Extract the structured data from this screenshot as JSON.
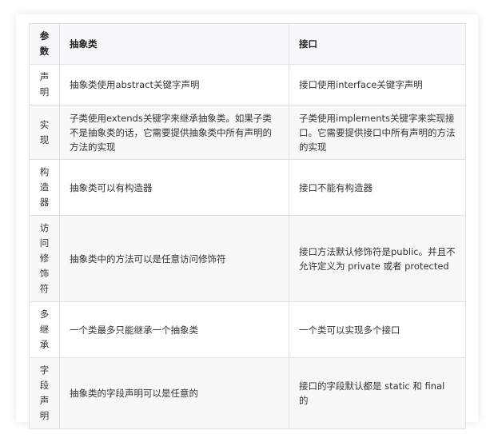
{
  "table": {
    "headers": [
      "参数",
      "抽象类",
      "接口"
    ],
    "rows": [
      {
        "param": "声明",
        "abstract": "抽象类使用abstract关键字声明",
        "interface": "接口使用interface关键字声明"
      },
      {
        "param": "实现",
        "abstract": "子类使用extends关键字来继承抽象类。如果子类不是抽象类的话，它需要提供抽象类中所有声明的方法的实现",
        "interface": "子类使用implements关键字来实现接口。它需要提供接口中所有声明的方法的实现"
      },
      {
        "param": "构造器",
        "abstract": "抽象类可以有构造器",
        "interface": "接口不能有构造器"
      },
      {
        "param": "访问修饰符",
        "abstract": "抽象类中的方法可以是任意访问修饰符",
        "interface": "接口方法默认修饰符是public。并且不允许定义为 private 或者 protected"
      },
      {
        "param": "多继承",
        "abstract": "一个类最多只能继承一个抽象类",
        "interface": "一个类可以实现多个接口"
      },
      {
        "param": "字段声明",
        "abstract": "抽象类的字段声明可以是任意的",
        "interface": "接口的字段默认都是 static 和 final 的"
      }
    ]
  }
}
